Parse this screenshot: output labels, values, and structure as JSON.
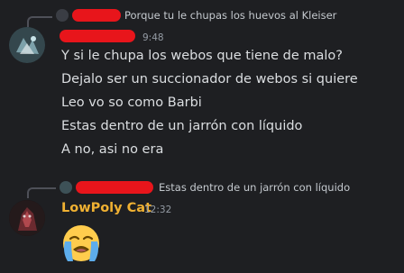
{
  "message1": {
    "reply_text": "Porque tu le chupas los huevos al Kleiser",
    "timestamp": "9:48",
    "lines": [
      "Y si le chupa los webos que tiene de malo?",
      "Dejalo ser un succionador de webos si quiere",
      "Leo vo so como Barbi",
      "Estas dentro de un jarrón con líquido",
      "A no, asi no era"
    ]
  },
  "message2": {
    "reply_text": "Estas dentro de un jarrón con líquido",
    "username": "LowPoly Cat",
    "timestamp": "12:32",
    "emoji": "loudly-crying-face"
  },
  "colors": {
    "background": "#1e1f22",
    "text": "#dbdee1",
    "username": "#f0b132",
    "timestamp": "#949ba4",
    "redaction": "#e8151b"
  }
}
